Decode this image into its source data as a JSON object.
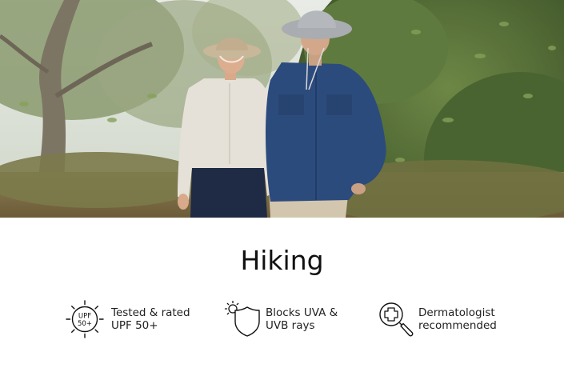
{
  "hero": {
    "image_name": "hikers-walking-in-forest-photo"
  },
  "title": "Hiking",
  "features": [
    {
      "icon": "upf-50-sun-icon",
      "badge_line1": "UPF",
      "badge_line2": "50+",
      "line1": "Tested & rated",
      "line2": "UPF 50+"
    },
    {
      "icon": "uv-shield-icon",
      "line1": "Blocks UVA &",
      "line2": "UVB rays"
    },
    {
      "icon": "dermatologist-magnifier-icon",
      "line1": "Dermatologist",
      "line2": "recommended"
    }
  ]
}
